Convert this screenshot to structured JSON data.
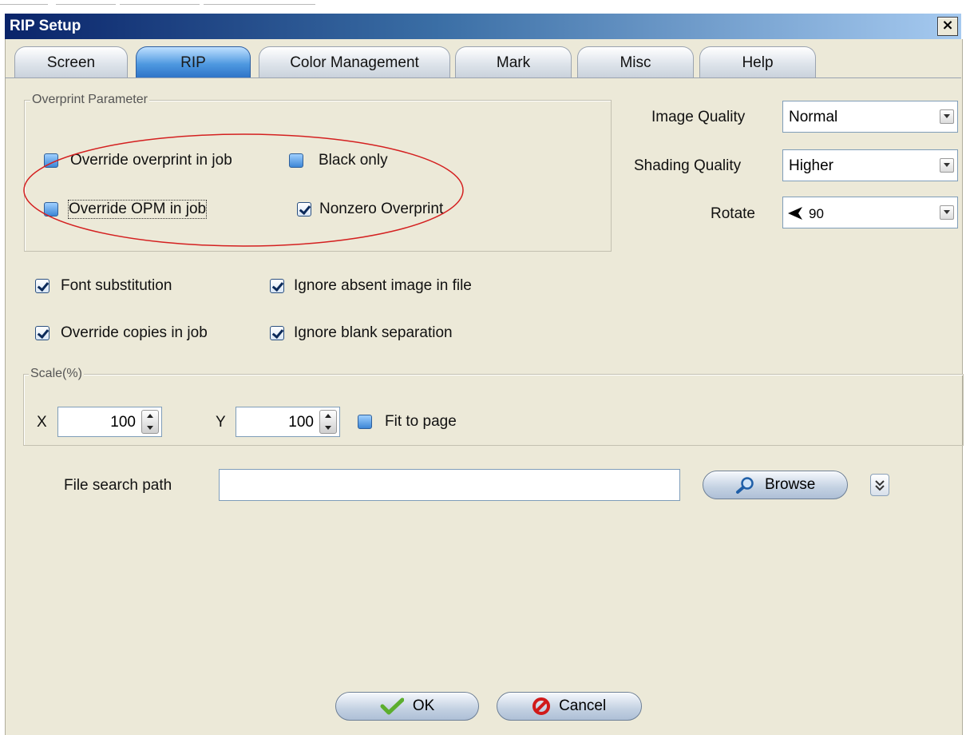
{
  "window": {
    "title": "RIP Setup",
    "close_glyph": "×"
  },
  "tabs": [
    {
      "label": "Screen",
      "active": false
    },
    {
      "label": "RIP",
      "active": true
    },
    {
      "label": "Color Management",
      "active": false
    },
    {
      "label": "Mark",
      "active": false
    },
    {
      "label": "Misc",
      "active": false
    },
    {
      "label": "Help",
      "active": false
    }
  ],
  "overprint": {
    "legend": "Overprint Parameter",
    "override_overprint": {
      "label": "Override overprint in job",
      "checked": false
    },
    "black_only": {
      "label": "Black only",
      "checked": false
    },
    "override_opm": {
      "label": "Override OPM in job",
      "checked": false
    },
    "nonzero_overprint": {
      "label": "Nonzero Overprint",
      "checked": true
    }
  },
  "quality": {
    "image_quality": {
      "label": "Image Quality",
      "value": "Normal"
    },
    "shading_quality": {
      "label": "Shading Quality",
      "value": "Higher"
    },
    "rotate": {
      "label": "Rotate",
      "value": "90",
      "icon": "arrow-left-icon"
    }
  },
  "options": {
    "font_substitution": {
      "label": "Font substitution",
      "checked": true
    },
    "ignore_absent_image": {
      "label": "Ignore absent image in file",
      "checked": true
    },
    "override_copies": {
      "label": "Override copies in job",
      "checked": true
    },
    "ignore_blank_separation": {
      "label": "Ignore blank separation",
      "checked": true
    }
  },
  "scale": {
    "legend": "Scale(%)",
    "x_label": "X",
    "x_value": "100",
    "y_label": "Y",
    "y_value": "100",
    "fit_to_page": {
      "label": "Fit to page",
      "checked": false
    }
  },
  "file_search": {
    "label": "File search path",
    "value": "",
    "browse_label": "Browse"
  },
  "footer": {
    "ok_label": "OK",
    "cancel_label": "Cancel"
  },
  "colors": {
    "annotation_ellipse": "#d42020",
    "dialog_bg": "#ece9d8"
  }
}
